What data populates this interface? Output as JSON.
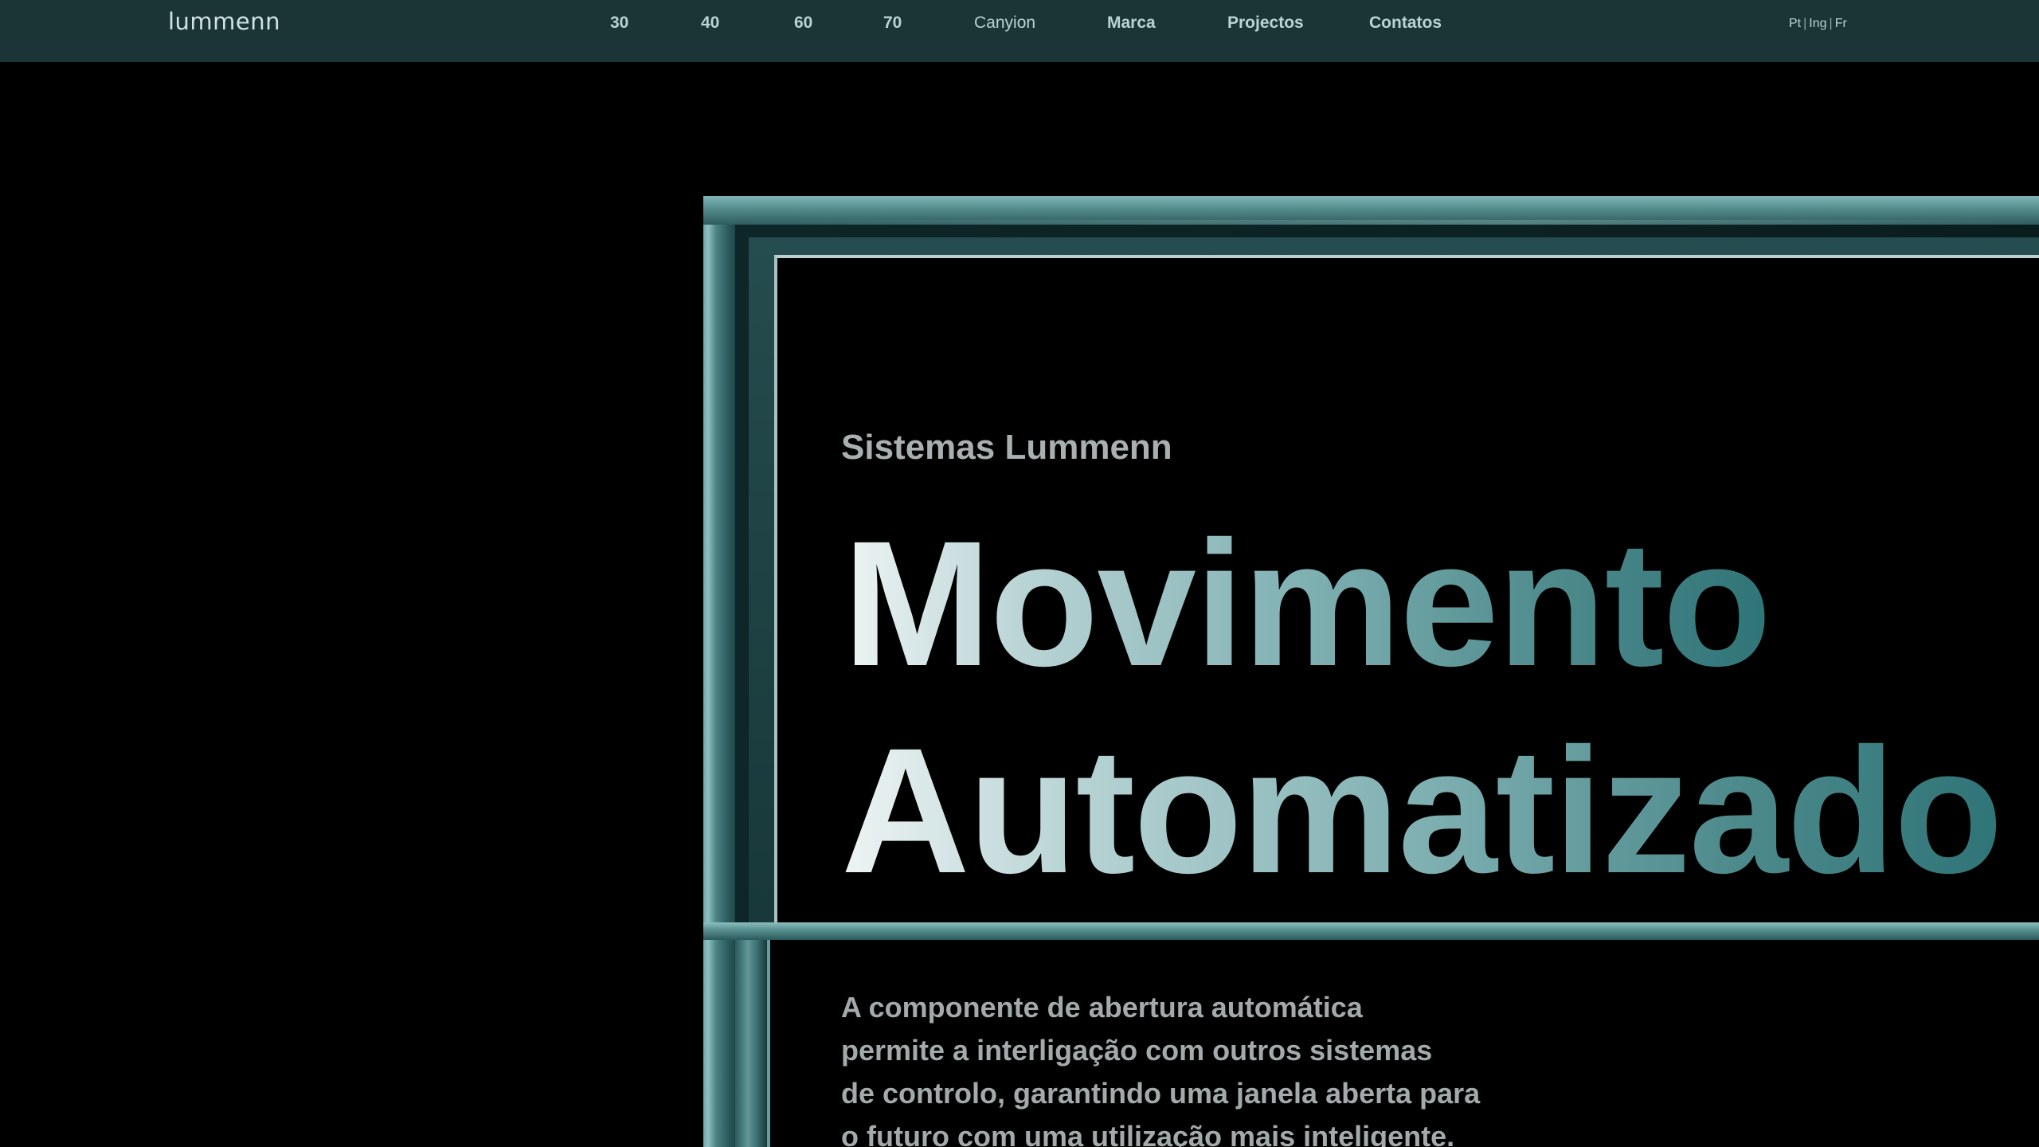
{
  "brand": {
    "logo_text": "lummenn"
  },
  "nav": {
    "items": [
      {
        "label": "30"
      },
      {
        "label": "40"
      },
      {
        "label": "60"
      },
      {
        "label": "70"
      },
      {
        "label": "Canyion"
      },
      {
        "label": "Marca"
      },
      {
        "label": "Projectos"
      },
      {
        "label": "Contatos"
      }
    ]
  },
  "languages": {
    "items": [
      "Pt",
      "Ing",
      "Fr"
    ],
    "separator": "|"
  },
  "hero": {
    "eyebrow": "Sistemas Lummenn",
    "title_line_1": "Movimento",
    "title_line_2": "Automatizado",
    "description_lines": [
      "A componente de abertura automática",
      "permite a interligação com outros sistemas",
      "de controlo, garantindo uma janela aberta para",
      "o futuro com uma utilização mais inteligente."
    ]
  },
  "colors": {
    "page_background": "#000000",
    "navbar_background": "#1b3537",
    "nav_text": "#b9d3d4",
    "frame_accent": "#5e9596",
    "title_gradient_start": "#eef4f4",
    "title_gradient_end": "#2f7477",
    "body_text": "#a3aaab"
  }
}
